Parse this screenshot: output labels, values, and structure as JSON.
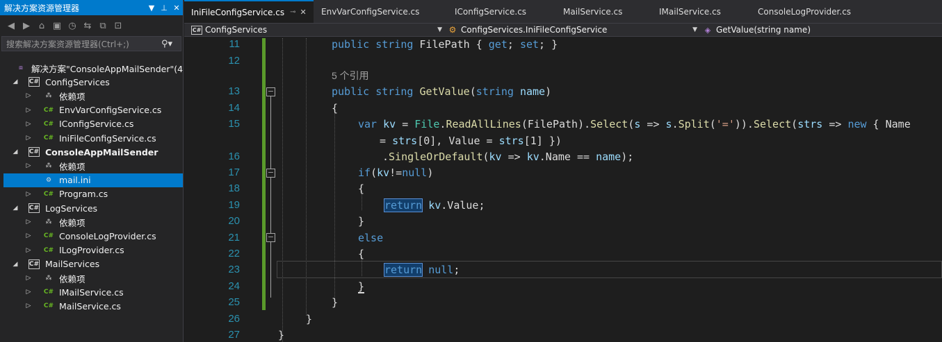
{
  "solution_explorer": {
    "title": "解决方案资源管理器",
    "search_placeholder": "搜索解决方案资源管理器(Ctrl+;)",
    "items": [
      {
        "label": "解决方案\"ConsoleAppMailSender\"(4",
        "icon": "solution-icon",
        "expanded": true,
        "bold": false
      },
      {
        "label": "ConfigServices",
        "icon": "csharp-project-icon",
        "expanded": true,
        "bold": false
      },
      {
        "label": "依赖项",
        "icon": "dependencies-icon",
        "expanded": false,
        "bold": false
      },
      {
        "label": "EnvVarConfigService.cs",
        "icon": "csharp-file-icon",
        "expanded": false,
        "bold": false
      },
      {
        "label": "IConfigService.cs",
        "icon": "csharp-file-icon",
        "expanded": false,
        "bold": false
      },
      {
        "label": "IniFileConfigService.cs",
        "icon": "csharp-file-icon",
        "expanded": false,
        "bold": false
      },
      {
        "label": "ConsoleAppMailSender",
        "icon": "csharp-project-icon",
        "expanded": true,
        "bold": true
      },
      {
        "label": "依赖项",
        "icon": "dependencies-icon",
        "expanded": false,
        "bold": false
      },
      {
        "label": "mail.ini",
        "icon": "config-file-icon",
        "expanded": null,
        "bold": false,
        "selected": true
      },
      {
        "label": "Program.cs",
        "icon": "csharp-file-icon",
        "expanded": false,
        "bold": false
      },
      {
        "label": "LogServices",
        "icon": "csharp-project-icon",
        "expanded": true,
        "bold": false
      },
      {
        "label": "依赖项",
        "icon": "dependencies-icon",
        "expanded": false,
        "bold": false
      },
      {
        "label": "ConsoleLogProvider.cs",
        "icon": "csharp-file-icon",
        "expanded": false,
        "bold": false
      },
      {
        "label": "ILogProvider.cs",
        "icon": "csharp-file-icon",
        "expanded": false,
        "bold": false
      },
      {
        "label": "MailServices",
        "icon": "csharp-project-icon",
        "expanded": true,
        "bold": false
      },
      {
        "label": "依赖项",
        "icon": "dependencies-icon",
        "expanded": false,
        "bold": false
      },
      {
        "label": "IMailService.cs",
        "icon": "csharp-file-icon",
        "expanded": false,
        "bold": false
      },
      {
        "label": "MailService.cs",
        "icon": "csharp-file-icon",
        "expanded": false,
        "bold": false
      }
    ]
  },
  "tabs": [
    {
      "label": "IniFileConfigService.cs",
      "active": true
    },
    {
      "label": "EnvVarConfigService.cs",
      "active": false
    },
    {
      "label": "IConfigService.cs",
      "active": false
    },
    {
      "label": "MailService.cs",
      "active": false
    },
    {
      "label": "IMailService.cs",
      "active": false
    },
    {
      "label": "ConsoleLogProvider.cs",
      "active": false
    }
  ],
  "navbar": {
    "project": "ConfigServices",
    "type": "ConfigServices.IniFileConfigService",
    "member": "GetValue(string name)"
  },
  "code": {
    "line_numbers": [
      "11",
      "12",
      "13",
      "14",
      "15",
      "16",
      "17",
      "18",
      "19",
      "20",
      "21",
      "22",
      "23",
      "24",
      "25",
      "26",
      "27"
    ],
    "reference_hint": "5 个引用",
    "lines": [
      {
        "n": "11",
        "text": "public string FilePath { get; set; }"
      },
      {
        "n": "12",
        "text": ""
      },
      {
        "n": "13",
        "text": "public string GetValue(string name)"
      },
      {
        "n": "14",
        "text": "{"
      },
      {
        "n": "15",
        "text": "var kv = File.ReadAllLines(FilePath).Select(s => s.Split('=')).Select(strs => new { Name"
      },
      {
        "n": "",
        "text": "= strs[0], Value = strs[1] })"
      },
      {
        "n": "16",
        "text": ".SingleOrDefault(kv => kv.Name == name);"
      },
      {
        "n": "17",
        "text": "if(kv!=null)"
      },
      {
        "n": "18",
        "text": "{"
      },
      {
        "n": "19",
        "text": "return kv.Value;"
      },
      {
        "n": "20",
        "text": "}"
      },
      {
        "n": "21",
        "text": "else"
      },
      {
        "n": "22",
        "text": "{"
      },
      {
        "n": "23",
        "text": "return null;"
      },
      {
        "n": "24",
        "text": "}"
      },
      {
        "n": "25",
        "text": "}"
      },
      {
        "n": "26",
        "text": "}"
      },
      {
        "n": "27",
        "text": "}"
      }
    ]
  },
  "colors": {
    "accent": "#007acc",
    "keyword": "#569cd6",
    "type": "#4ec9b0",
    "method": "#dcdcaa",
    "string": "#d69d85",
    "line_number": "#2b91af"
  }
}
